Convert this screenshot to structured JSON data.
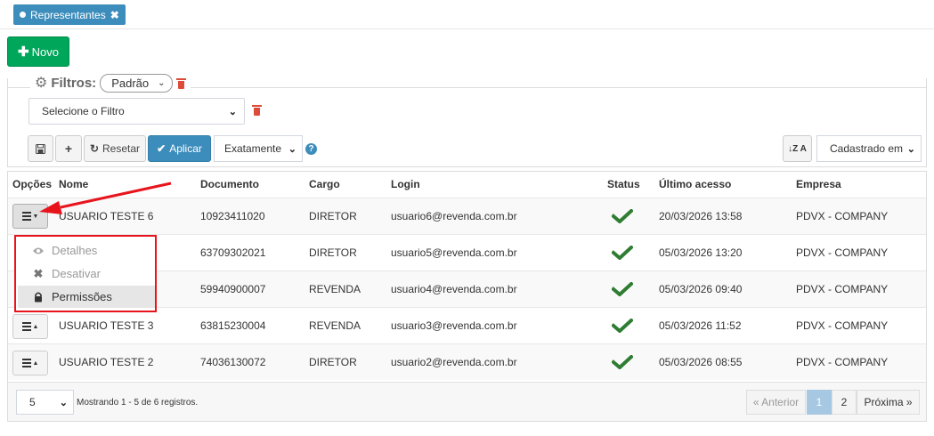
{
  "tab": {
    "label": "Representantes",
    "close": "✖"
  },
  "new_button": {
    "label": "Novo"
  },
  "filters": {
    "title": "Filtros:",
    "preset": "Padrão",
    "select_placeholder": "Selecione o Filtro",
    "reset_label": "Resetar",
    "apply_label": "Aplicar",
    "match_mode": "Exatamente",
    "sort_field": "Cadastrado em",
    "sort_icon_text": "↓Z A"
  },
  "table": {
    "headers": {
      "options": "Opções",
      "name": "Nome",
      "document": "Documento",
      "role": "Cargo",
      "login": "Login",
      "status": "Status",
      "last_access": "Último acesso",
      "company": "Empresa"
    },
    "rows": [
      {
        "name": "USUARIO TESTE 6",
        "document": "10923411020",
        "role": "DIRETOR",
        "login": "usuario6@revenda.com.br",
        "status": "active",
        "last_access": "20/03/2026 13:58",
        "company": "PDVX - COMPANY"
      },
      {
        "name": "",
        "document": "63709302021",
        "role": "DIRETOR",
        "login": "usuario5@revenda.com.br",
        "status": "active",
        "last_access": "05/03/2026 13:20",
        "company": "PDVX - COMPANY"
      },
      {
        "name": "",
        "document": "59940900007",
        "role": "REVENDA",
        "login": "usuario4@revenda.com.br",
        "status": "active",
        "last_access": "05/03/2026 09:40",
        "company": "PDVX - COMPANY"
      },
      {
        "name": "USUARIO TESTE 3",
        "document": "63815230004",
        "role": "REVENDA",
        "login": "usuario3@revenda.com.br",
        "status": "active",
        "last_access": "05/03/2026 11:52",
        "company": "PDVX - COMPANY"
      },
      {
        "name": "USUARIO TESTE 2",
        "document": "74036130072",
        "role": "DIRETOR",
        "login": "usuario2@revenda.com.br",
        "status": "active",
        "last_access": "05/03/2026 08:55",
        "company": "PDVX - COMPANY"
      }
    ]
  },
  "dropdown": {
    "items": [
      {
        "label": "Detalhes",
        "icon": "eye-icon"
      },
      {
        "label": "Desativar",
        "icon": "times-icon"
      },
      {
        "label": "Permissões",
        "icon": "lock-icon"
      }
    ]
  },
  "footer": {
    "page_size": "5",
    "showing_text": "Mostrando 1 - 5 de 6 registros.",
    "prev_label": "« Anterior",
    "pages": [
      "1",
      "2"
    ],
    "next_label": "Próxima »"
  },
  "colors": {
    "primary": "#3c8dbc",
    "success": "#00a65a",
    "danger": "#dd4b39",
    "highlight": "#e8141c",
    "check": "#2e7d32"
  }
}
